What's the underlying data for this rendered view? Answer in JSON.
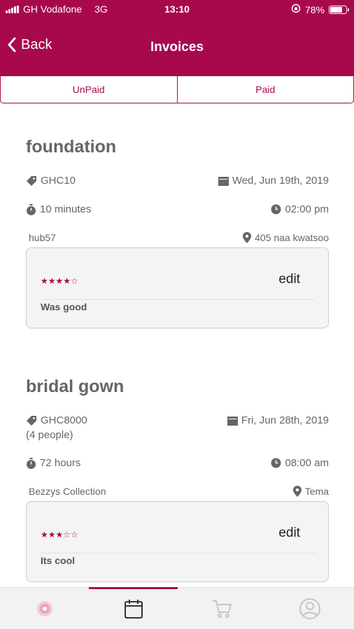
{
  "status": {
    "carrier": "GH Vodafone",
    "network": "3G",
    "time": "13:10",
    "battery": "78%",
    "battery_level": 0.78
  },
  "nav": {
    "back_label": "Back",
    "title": "Invoices"
  },
  "tabs": [
    {
      "label": "UnPaid"
    },
    {
      "label": "Paid"
    }
  ],
  "invoices": [
    {
      "title": "foundation",
      "price": "GHC10",
      "people": "",
      "date": "Wed, Jun 19th, 2019",
      "duration": "10 minutes",
      "time": "02:00 pm",
      "vendor": "hub57",
      "location": "405 naa kwatsoo",
      "stars": "★★★★☆",
      "rating": 4,
      "edit_label": "edit",
      "comment": "Was good"
    },
    {
      "title": "bridal gown",
      "price": "GHC8000",
      "people": "(4 people)",
      "date": "Fri, Jun 28th, 2019",
      "duration": "72 hours",
      "time": "08:00 am",
      "vendor": "Bezzys Collection",
      "location": "Tema",
      "stars": "★★★☆☆",
      "rating": 3,
      "edit_label": "edit",
      "comment": "Its cool"
    }
  ],
  "bottom_nav": [
    {
      "icon": "loader-icon"
    },
    {
      "icon": "calendar-icon",
      "active": true
    },
    {
      "icon": "cart-icon"
    },
    {
      "icon": "user-icon"
    }
  ],
  "colors": {
    "brand": "#a8094d",
    "text": "#666666",
    "card_bg": "#f4f4f4"
  }
}
